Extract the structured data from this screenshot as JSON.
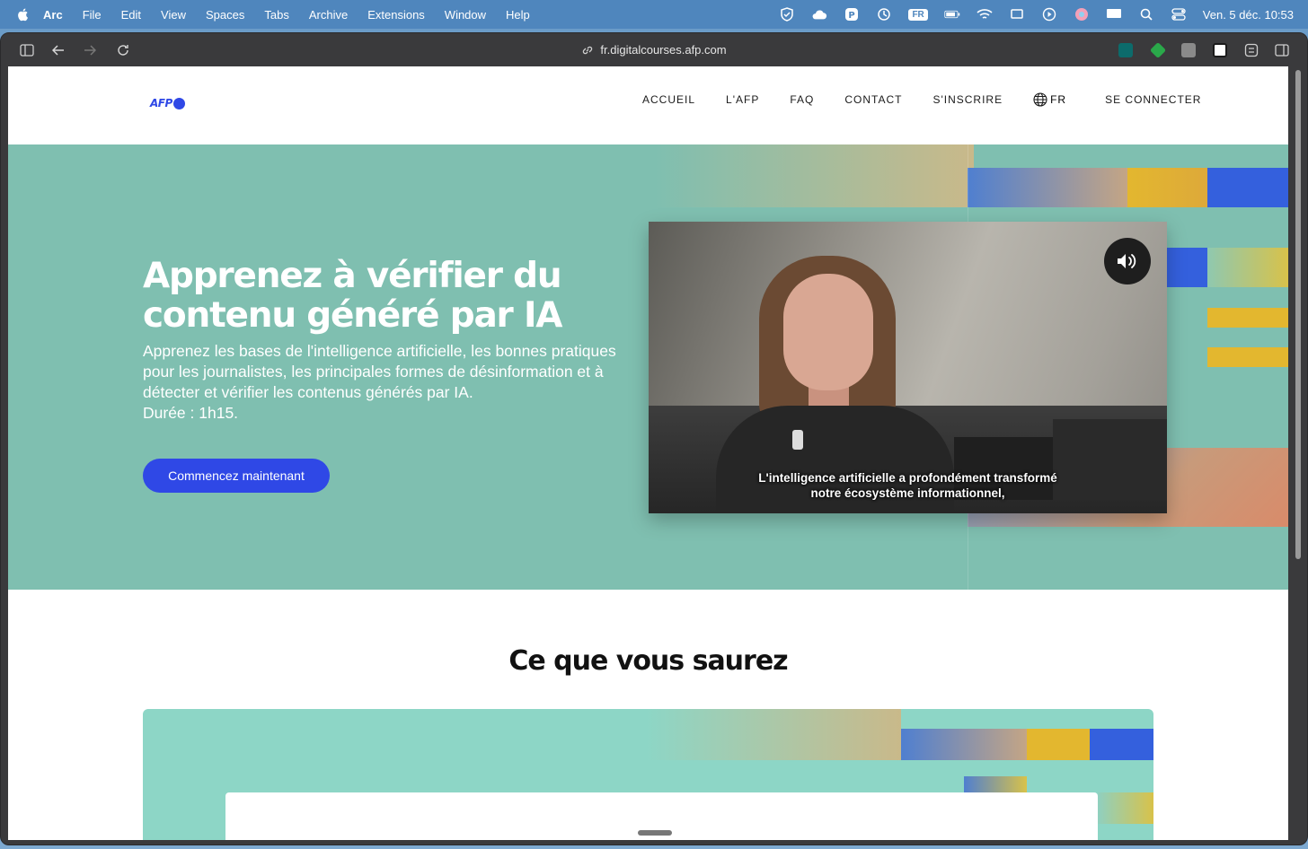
{
  "menubar": {
    "app": "Arc",
    "items": [
      "File",
      "Edit",
      "View",
      "Spaces",
      "Tabs",
      "Archive",
      "Extensions",
      "Window",
      "Help"
    ],
    "input_badge": "FR",
    "clock": "Ven. 5 déc.  10:53"
  },
  "browser": {
    "url": "fr.digitalcourses.afp.com"
  },
  "site": {
    "logo": "AFP",
    "nav": {
      "home": "ACCUEIL",
      "afp": "L'AFP",
      "faq": "FAQ",
      "contact": "CONTACT",
      "signup": "S'INSCRIRE",
      "lang": "FR",
      "login": "SE CONNECTER"
    },
    "hero": {
      "title": "Apprenez à vérifier du contenu généré par IA",
      "description": "Apprenez les bases de l'intelligence artificielle, les bonnes pratiques pour les journalistes, les principales formes de désinformation et à détecter et vérifier les contenus générés par IA.",
      "duration": "Durée : 1h15.",
      "cta": "Commencez maintenant",
      "subtitle_line1": "L'intelligence artificielle a profondément transformé",
      "subtitle_line2": "notre écosystème informationnel,"
    },
    "section_title": "Ce que vous saurez"
  },
  "colors": {
    "hero_bg": "#7fbfb0",
    "brand_blue": "#2f48e6",
    "yellow": "#e3b72f",
    "card_bg": "#8dd6c6"
  }
}
